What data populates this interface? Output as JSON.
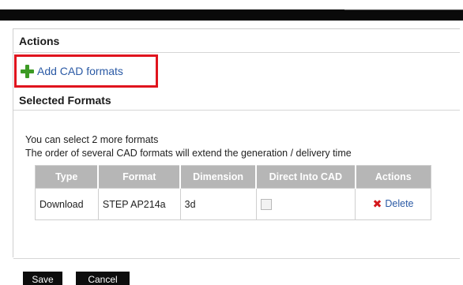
{
  "actions": {
    "header": "Actions",
    "add_cad_label": "Add CAD formats"
  },
  "selected_formats": {
    "header": "Selected Formats",
    "info_line_1": "You can select 2 more formats",
    "info_line_2": "The order of several CAD formats will extend the generation / delivery time",
    "table": {
      "columns": [
        "Type",
        "Format",
        "Dimension",
        "Direct Into CAD",
        "Actions"
      ],
      "rows": [
        {
          "type": "Download",
          "format": "STEP AP214a",
          "dimension": "3d",
          "direct_into_cad": false,
          "action": "Delete"
        }
      ]
    }
  },
  "footer": {
    "save_label": "Save",
    "cancel_label": "Cancel"
  },
  "colors": {
    "highlight_border": "#e0141e",
    "link": "#2b5aa5",
    "plus_icon": "#3c9a24",
    "delete_icon": "#d4191d",
    "table_header_bg": "#b6b6b6",
    "button_bg": "#0d0d0d"
  },
  "icons": {
    "add": "plus-icon",
    "delete": "x-icon"
  }
}
